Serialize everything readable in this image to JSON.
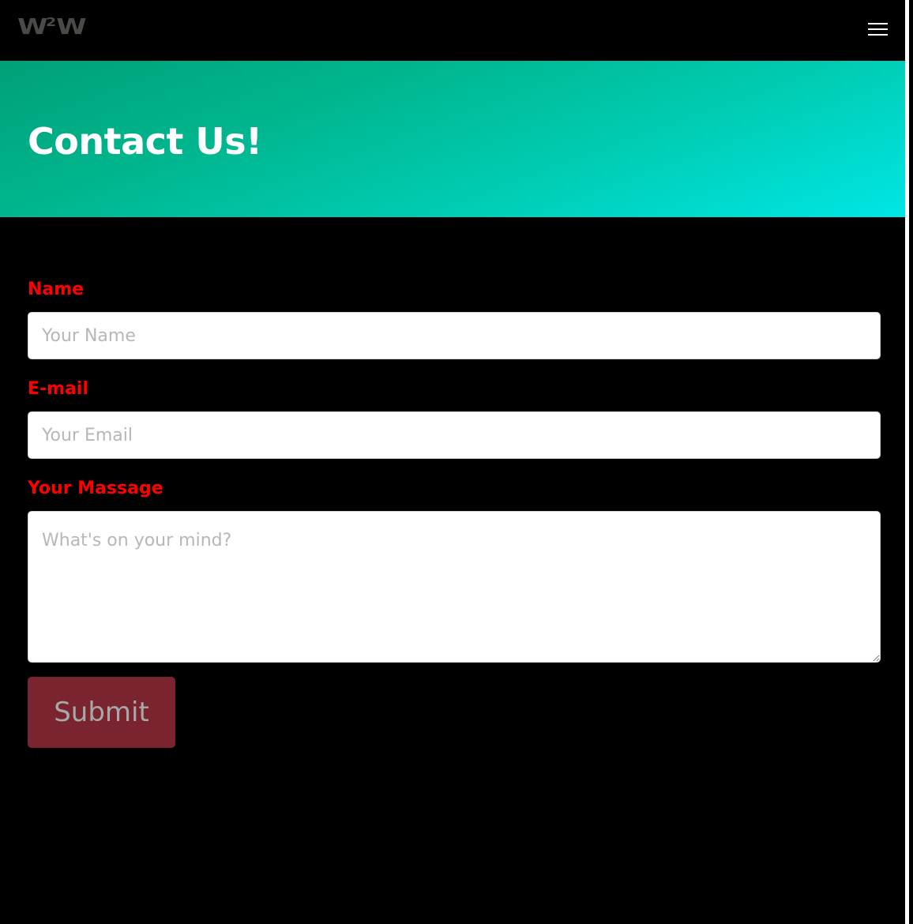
{
  "navbar": {
    "brand_main": "W",
    "brand_sup": "2",
    "brand_tail": "W",
    "menu_icon": "hamburger-menu-icon"
  },
  "hero": {
    "title": "Contact Us!",
    "gradient_from": "#00a078",
    "gradient_to": "#00e6e6"
  },
  "form": {
    "name_label": "Name",
    "name_placeholder": "Your Name",
    "email_label": "E-mail",
    "email_placeholder": "Your Email",
    "message_label": "Your Massage",
    "message_placeholder": "What's on your mind?",
    "submit_label": "Submit",
    "label_color": "#ff0000",
    "submit_color": "#7a2430"
  }
}
